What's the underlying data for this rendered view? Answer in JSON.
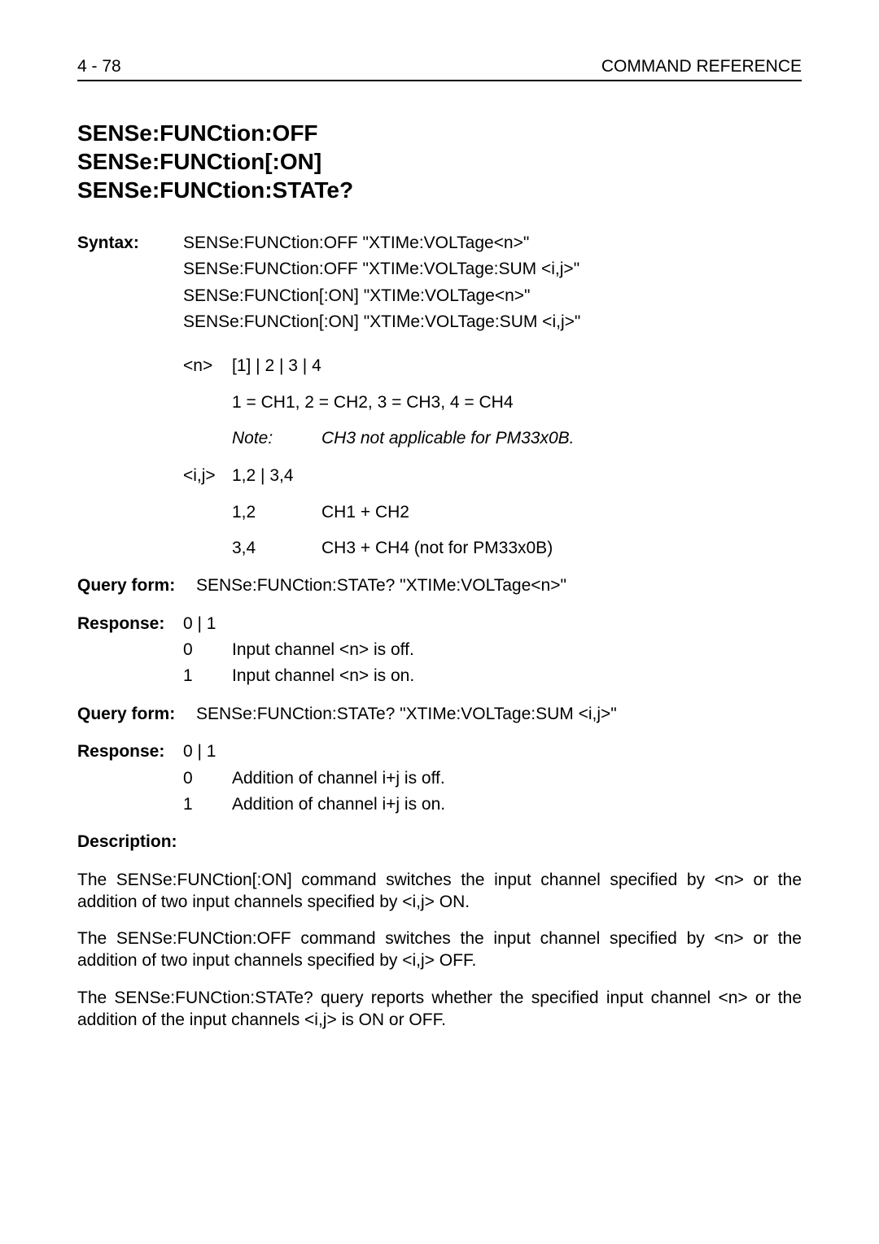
{
  "header": {
    "page_ref": "4 - 78",
    "section": "COMMAND REFERENCE"
  },
  "title": {
    "line1": "SENSe:FUNCtion:OFF",
    "line2": "SENSe:FUNCtion[:ON]",
    "line3": "SENSe:FUNCtion:STATe?"
  },
  "syntax": {
    "label": "Syntax:",
    "l1": "SENSe:FUNCtion:OFF \"XTIMe:VOLTage<n>\"",
    "l2": "SENSe:FUNCtion:OFF \"XTIMe:VOLTage:SUM <i,j>\"",
    "l3": "SENSe:FUNCtion[:ON] \"XTIMe:VOLTage<n>\"",
    "l4": "SENSe:FUNCtion[:ON] \"XTIMe:VOLTage:SUM <i,j>\""
  },
  "n_param": {
    "tag": "<n>",
    "options": "[1] | 2 | 3 | 4",
    "mapping": "1 = CH1, 2 = CH2, 3 = CH3, 4 = CH4",
    "note_label": "Note:",
    "note_text": "CH3 not applicable for PM33x0B."
  },
  "ij_param": {
    "tag": "<i,j>",
    "options": "1,2 | 3,4",
    "r1_key": "1,2",
    "r1_val": "CH1 + CH2",
    "r2_key": "3,4",
    "r2_val": "CH3 + CH4 (not for PM33x0B)"
  },
  "query1": {
    "label": "Query form:",
    "text": "SENSe:FUNCtion:STATe? \"XTIMe:VOLTage<n>\""
  },
  "resp1": {
    "label": "Response:",
    "options": "0 | 1",
    "r0_key": "0",
    "r0_val": "Input channel <n> is off.",
    "r1_key": "1",
    "r1_val": "Input channel <n> is on."
  },
  "query2": {
    "label": "Query form:",
    "text": "SENSe:FUNCtion:STATe? \"XTIMe:VOLTage:SUM <i,j>\""
  },
  "resp2": {
    "label": "Response:",
    "options": "0 | 1",
    "r0_key": "0",
    "r0_val": "Addition of channel i+j is off.",
    "r1_key": "1",
    "r1_val": "Addition of channel i+j is on."
  },
  "description": {
    "label": "Description:",
    "p1": "The SENSe:FUNCtion[:ON] command switches the input channel specified by <n> or the addition of two input channels specified by <i,j> ON.",
    "p2": "The SENSe:FUNCtion:OFF command switches the input channel specified by <n> or the addition of two input channels specified by <i,j> OFF.",
    "p3": "The SENSe:FUNCtion:STATe? query reports whether the specified input channel <n> or the addition of the input channels <i,j> is ON or OFF."
  }
}
